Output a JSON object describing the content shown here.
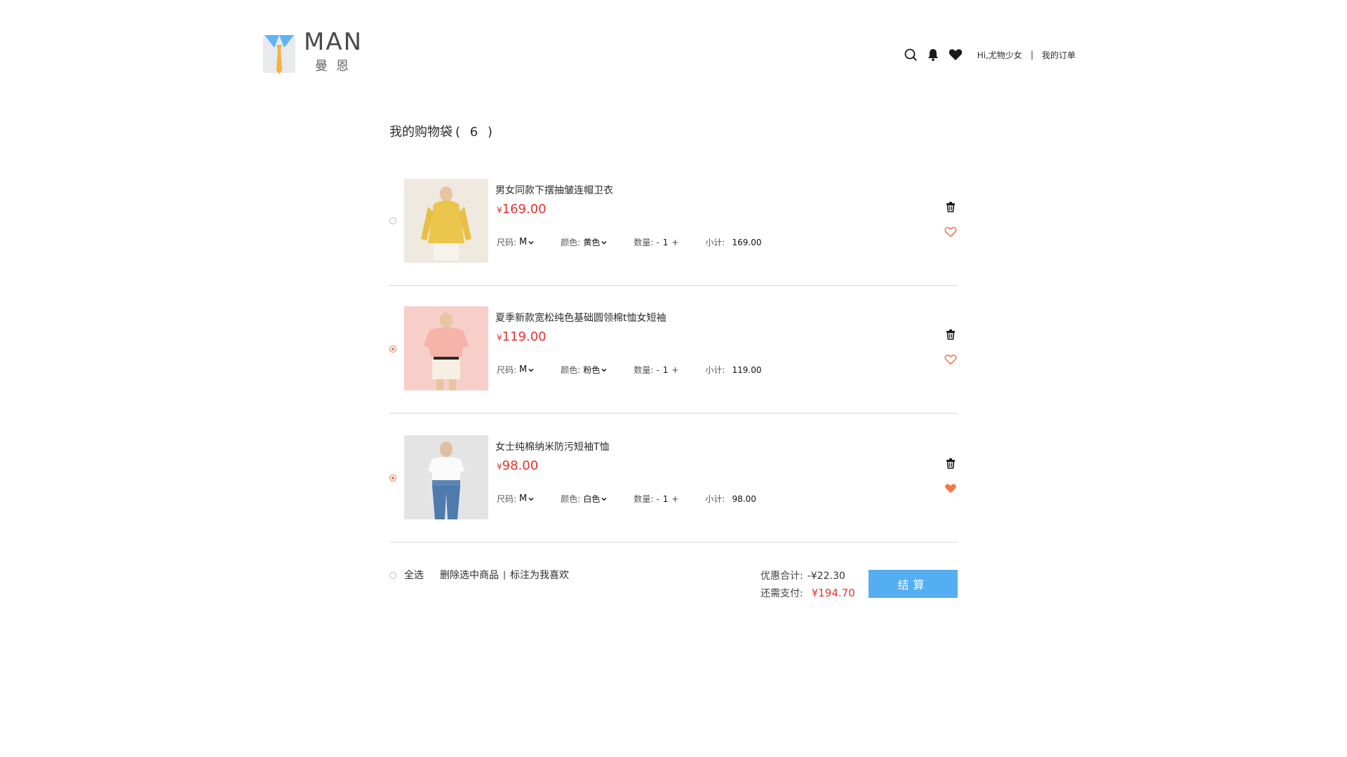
{
  "brand": {
    "name": "MAN",
    "subtitle": "曼恩",
    "colors": {
      "tie": "#f6b23c",
      "collar": "#5fb4f3",
      "shirt": "#e8eaee"
    }
  },
  "nav": {
    "icons": [
      "search-icon",
      "bell-icon",
      "heart-icon"
    ],
    "greeting": "Hi,尤物少女",
    "separator": "|",
    "orders_link": "我的订单"
  },
  "cart": {
    "title": "我的购物袋",
    "count": "( 6 )",
    "items": [
      {
        "name": "男女同款下摆抽皱连帽卫衣",
        "currency": "¥",
        "price": "169.00",
        "checked": false,
        "size_label": "尺码:",
        "size": "M",
        "color_label": "颜色:",
        "color": "黄色",
        "qty_label": "数量:",
        "qty_minus": "-",
        "qty": "1",
        "qty_plus": "+",
        "subtotal_label": "小计:",
        "subtotal": "169.00",
        "favorited": false,
        "image_bg": "#f2d27a"
      },
      {
        "name": "夏季新款宽松纯色基础圆领棉t恤女短袖",
        "currency": "¥",
        "price": "119.00",
        "checked": true,
        "size_label": "尺码:",
        "size": "M",
        "color_label": "颜色:",
        "color": "粉色",
        "qty_label": "数量:",
        "qty_minus": "-",
        "qty": "1",
        "qty_plus": "+",
        "subtotal_label": "小计:",
        "subtotal": "119.00",
        "favorited": false,
        "image_bg": "#f6c9c2"
      },
      {
        "name": "女士纯棉纳米防污短袖T恤",
        "currency": "¥",
        "price": "98.00",
        "checked": true,
        "size_label": "尺码:",
        "size": "M",
        "color_label": "颜色:",
        "color": "白色",
        "qty_label": "数量:",
        "qty_minus": "-",
        "qty": "1",
        "qty_plus": "+",
        "subtotal_label": "小计:",
        "subtotal": "98.00",
        "favorited": true,
        "image_bg": "#e3e3e3"
      }
    ]
  },
  "footer": {
    "select_all": "全选",
    "delete_selected": "删除选中商品",
    "separator": "|",
    "mark_favorite": "标注为我喜欢",
    "discount_label": "优惠合计:",
    "discount_value": "-¥22.30",
    "pay_label": "还需支付:",
    "pay_value": "¥194.70",
    "checkout": "结算"
  },
  "colors": {
    "accent_orange": "#f07a45",
    "price_red": "#e8322e",
    "checkout_blue": "#55adf2"
  }
}
